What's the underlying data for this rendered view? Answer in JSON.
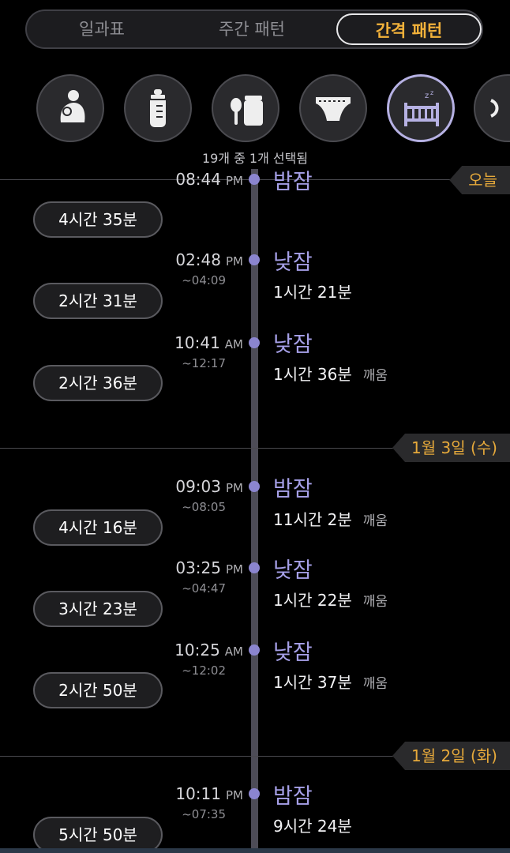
{
  "tabs": [
    {
      "label": "일과표"
    },
    {
      "label": "주간 패턴"
    },
    {
      "label": "간격 패턴"
    }
  ],
  "icons": [
    "breastfeeding-icon",
    "bottle-icon",
    "baby-food-icon",
    "diaper-icon",
    "sleep-crib-icon",
    "more-icon"
  ],
  "selection_count": "19개 중 1개 선택됨",
  "days": [
    {
      "label": "오늘"
    },
    {
      "label": "1월 3일 (수)"
    },
    {
      "label": "1월 2일 (화)"
    }
  ],
  "events": [
    {
      "time": "08:44",
      "ampm": "PM",
      "end": "",
      "name": "밤잠",
      "duration": "",
      "wake": ""
    },
    {
      "time": "02:48",
      "ampm": "PM",
      "end": "~04:09",
      "name": "낮잠",
      "duration": "1시간 21분",
      "wake": ""
    },
    {
      "time": "10:41",
      "ampm": "AM",
      "end": "~12:17",
      "name": "낮잠",
      "duration": "1시간 36분",
      "wake": "깨움"
    },
    {
      "time": "09:03",
      "ampm": "PM",
      "end": "~08:05",
      "name": "밤잠",
      "duration": "11시간 2분",
      "wake": "깨움"
    },
    {
      "time": "03:25",
      "ampm": "PM",
      "end": "~04:47",
      "name": "낮잠",
      "duration": "1시간 22분",
      "wake": "깨움"
    },
    {
      "time": "10:25",
      "ampm": "AM",
      "end": "~12:02",
      "name": "낮잠",
      "duration": "1시간 37분",
      "wake": "깨움"
    },
    {
      "time": "10:11",
      "ampm": "PM",
      "end": "~07:35",
      "name": "밤잠",
      "duration": "9시간 24분",
      "wake": ""
    }
  ],
  "intervals": [
    "4시간 35분",
    "2시간 31분",
    "2시간 36분",
    "4시간 16분",
    "3시간 23분",
    "2시간 50분",
    "5시간 50분"
  ],
  "colors": {
    "accent_orange": "#f3b23a",
    "accent_purple": "#a6a0e8",
    "day_tag_text": "#e6a93b"
  }
}
